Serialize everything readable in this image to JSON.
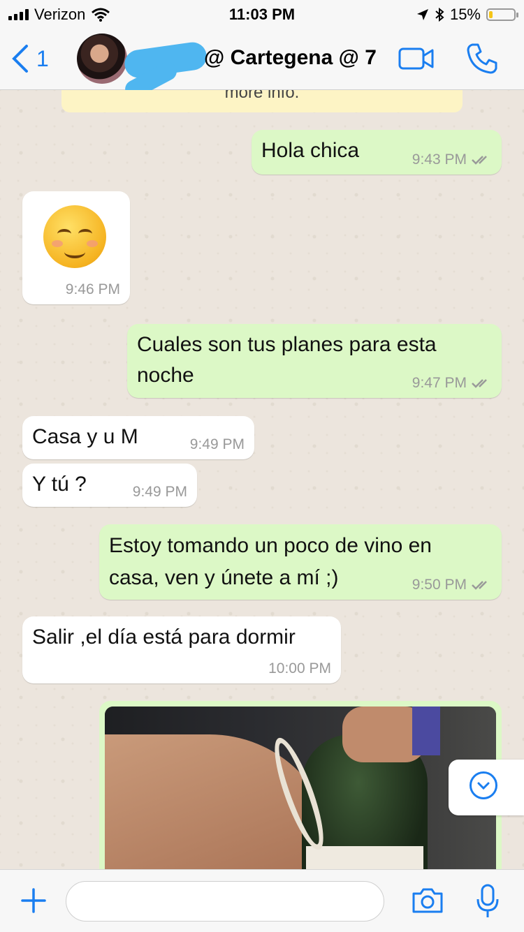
{
  "status_bar": {
    "carrier": "Verizon",
    "time": "11:03 PM",
    "battery_text": "15%",
    "battery_level": 0.15
  },
  "nav": {
    "back_count": "1",
    "title": "@ Cartegena @ 7"
  },
  "notice": {
    "text": "more info."
  },
  "messages": [
    {
      "dir": "out",
      "text": "Hola chica",
      "time": "9:43 PM"
    },
    {
      "dir": "in",
      "text": "",
      "emoji": "smiling-face-icon",
      "time": "9:46 PM"
    },
    {
      "dir": "out",
      "text_line1": "Cuales son tus planes para esta",
      "text_line2": "noche",
      "time": "9:47 PM"
    },
    {
      "dir": "in",
      "text": "Casa y u M",
      "time": "9:49 PM"
    },
    {
      "dir": "in",
      "text": "Y tú ?",
      "time": "9:49 PM"
    },
    {
      "dir": "out",
      "text_line1": "Estoy tomando un poco de vino en",
      "text_line2": "casa, ven y únete a mí ;)",
      "time": "9:50 PM"
    },
    {
      "dir": "in",
      "text": "Salir ,el día está para dormir",
      "time": "10:00 PM"
    }
  ],
  "colors": {
    "accent": "#1a7ef0",
    "outgoing_bubble": "#dcf8c6",
    "incoming_bubble": "#ffffff",
    "chat_background": "#ece5dd"
  },
  "input": {
    "placeholder": ""
  }
}
